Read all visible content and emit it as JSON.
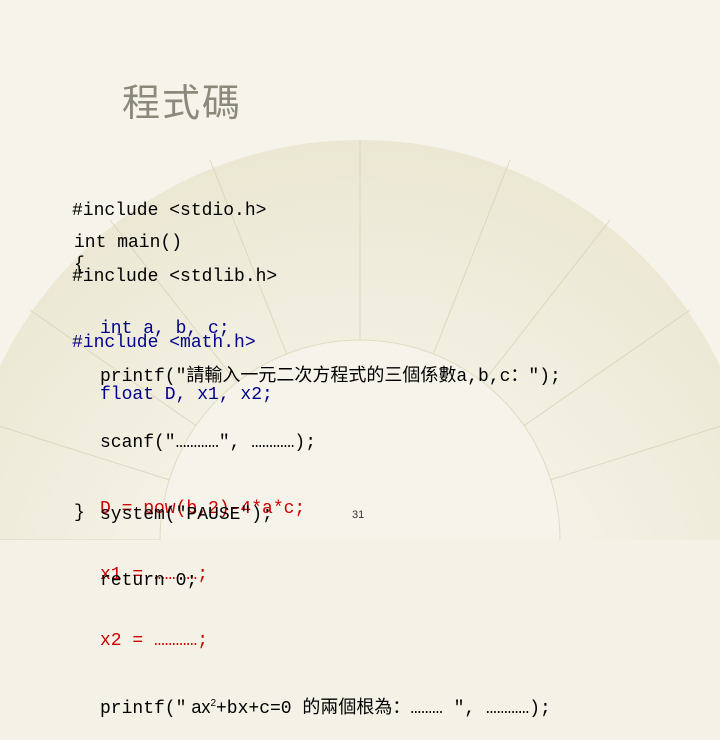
{
  "title": "程式碼",
  "includes": [
    "#include <stdio.h>",
    "#include <stdlib.h>",
    "#include <math.h>"
  ],
  "main_sig": "int main()",
  "open_brace": "{",
  "decl1": "int a, b, c;",
  "decl2": "float D, x1, x2;",
  "printf1": "printf(\"請輸入一元二次方程式的三個係數a,b,c：\");",
  "scanf": "scanf(\"…………\", …………);",
  "dline": "D = pow(b,2)-4*a*c;",
  "x1line": "x1 = …………;",
  "x2line": "x2 = …………;",
  "printf2_pre": "printf(\"",
  "printf2_mid1": " ax",
  "printf2_sup": "2",
  "printf2_mid2": "+bx+c=0 的兩個根為：……… \", …………);",
  "system": "system(\"PAUSE\");",
  "ret": "return 0;",
  "close_brace": "}",
  "page_number": "31"
}
